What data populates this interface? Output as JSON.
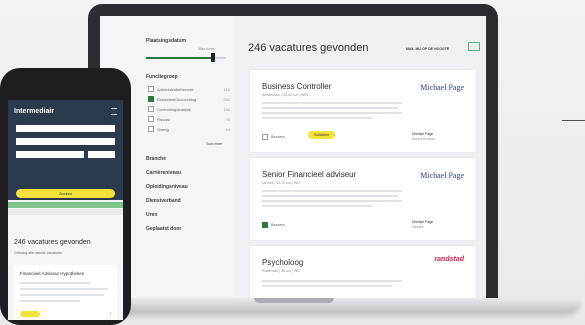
{
  "sidebar": {
    "title": "Plaatsingsdatum",
    "subtitle": "Alles tonen",
    "groups": [
      {
        "label": "Functiegroep"
      },
      {
        "label": "Branche"
      },
      {
        "label": "Carrièreniveau"
      },
      {
        "label": "Opleidingsniveau"
      },
      {
        "label": "Dienstverband"
      },
      {
        "label": "Uren"
      },
      {
        "label": "Geplaatst door"
      }
    ],
    "items": [
      {
        "label": "Administratief/secret.",
        "count": "116",
        "checked": false
      },
      {
        "label": "Financieel/Accounting",
        "count": "246",
        "checked": true
      },
      {
        "label": "Controlling/analyse",
        "count": "136",
        "checked": false
      },
      {
        "label": "Fiscaal",
        "count": "78",
        "checked": false
      },
      {
        "label": "Overig",
        "count": "44",
        "checked": false
      }
    ],
    "more": "Toon meer"
  },
  "results": {
    "title": "246 vacatures gevonden",
    "alert": "MAIL MIJ OP DE HOOGTE"
  },
  "cards": [
    {
      "title": "Business Controller",
      "meta": "Amsterdam | 40-45 uur | HBO",
      "logo": "Michael Page",
      "save": "Bewaren",
      "apply": "Solliciteer",
      "company": "Michael Page",
      "location": "Noord-Holland"
    },
    {
      "title": "Senior Financieel adviseur",
      "meta": "Utrecht | 32-40 uur | WO",
      "logo": "Michael Page",
      "save": "Bewaren",
      "company": "Michael Page",
      "location": "Utrecht"
    },
    {
      "title": "Psycholoog",
      "meta": "Rotterdam | 36 uur | WO",
      "logo": "randstad"
    }
  ],
  "phone": {
    "logo": "Intermediair",
    "search_button": "Zoeken",
    "results": "246 vacatures gevonden",
    "note": "Ontvang alle nieuwe vacatures",
    "card_title": "Financieel Adviseur Hypotheken"
  },
  "colors": {
    "accent_yellow": "#f3e23b",
    "accent_green": "#2d7a3e",
    "header_navy": "#2b3a4d",
    "michael_page_blue": "#283b8c",
    "randstad_red": "#d2234b"
  }
}
